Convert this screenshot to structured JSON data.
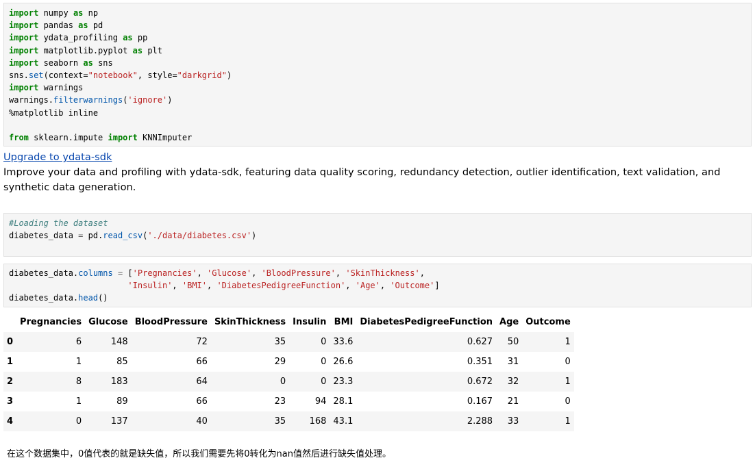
{
  "cell1": {
    "lines": [
      [
        {
          "t": "import",
          "c": "kw"
        },
        {
          "t": " numpy "
        },
        {
          "t": "as",
          "c": "kw"
        },
        {
          "t": " np"
        }
      ],
      [
        {
          "t": "import",
          "c": "kw"
        },
        {
          "t": " pandas "
        },
        {
          "t": "as",
          "c": "kw"
        },
        {
          "t": " pd"
        }
      ],
      [
        {
          "t": "import",
          "c": "kw"
        },
        {
          "t": " ydata_profiling "
        },
        {
          "t": "as",
          "c": "kw"
        },
        {
          "t": " pp"
        }
      ],
      [
        {
          "t": "import",
          "c": "kw"
        },
        {
          "t": " matplotlib.pyplot "
        },
        {
          "t": "as",
          "c": "kw"
        },
        {
          "t": " plt"
        }
      ],
      [
        {
          "t": "import",
          "c": "kw"
        },
        {
          "t": " seaborn "
        },
        {
          "t": "as",
          "c": "kw"
        },
        {
          "t": " sns"
        }
      ],
      [
        {
          "t": "sns."
        },
        {
          "t": "set",
          "c": "fn"
        },
        {
          "t": "(context="
        },
        {
          "t": "\"notebook\"",
          "c": "str"
        },
        {
          "t": ", style="
        },
        {
          "t": "\"darkgrid\"",
          "c": "str"
        },
        {
          "t": ")"
        }
      ],
      [
        {
          "t": "import",
          "c": "kw"
        },
        {
          "t": " warnings"
        }
      ],
      [
        {
          "t": "warnings."
        },
        {
          "t": "filterwarnings",
          "c": "fn"
        },
        {
          "t": "("
        },
        {
          "t": "'ignore'",
          "c": "str"
        },
        {
          "t": ")"
        }
      ],
      [
        {
          "t": "%matplotlib inline"
        }
      ],
      [
        {
          "t": ""
        }
      ],
      [
        {
          "t": "from",
          "c": "kw"
        },
        {
          "t": " sklearn.impute "
        },
        {
          "t": "import",
          "c": "kw"
        },
        {
          "t": " KNNImputer"
        }
      ]
    ]
  },
  "markdown1": {
    "link_text": "Upgrade to ydata-sdk",
    "body": "Improve your data and profiling with ydata-sdk, featuring data quality scoring, redundancy detection, outlier identification, text validation, and synthetic data generation."
  },
  "cell2": {
    "lines": [
      [
        {
          "t": "#Loading the dataset",
          "c": "cmt"
        }
      ],
      [
        {
          "t": "diabetes_data "
        },
        {
          "t": "=",
          "c": "op"
        },
        {
          "t": " pd."
        },
        {
          "t": "read_csv",
          "c": "fn"
        },
        {
          "t": "("
        },
        {
          "t": "'./data/diabetes.csv'",
          "c": "str"
        },
        {
          "t": ")"
        }
      ]
    ]
  },
  "cell3": {
    "lines": [
      [
        {
          "t": "diabetes_data."
        },
        {
          "t": "columns",
          "c": "fn"
        },
        {
          "t": " "
        },
        {
          "t": "=",
          "c": "op"
        },
        {
          "t": " ["
        },
        {
          "t": "'Pregnancies'",
          "c": "str"
        },
        {
          "t": ", "
        },
        {
          "t": "'Glucose'",
          "c": "str"
        },
        {
          "t": ", "
        },
        {
          "t": "'BloodPressure'",
          "c": "str"
        },
        {
          "t": ", "
        },
        {
          "t": "'SkinThickness'",
          "c": "str"
        },
        {
          "t": ","
        }
      ],
      [
        {
          "t": "                        "
        },
        {
          "t": "'Insulin'",
          "c": "str"
        },
        {
          "t": ", "
        },
        {
          "t": "'BMI'",
          "c": "str"
        },
        {
          "t": ", "
        },
        {
          "t": "'DiabetesPedigreeFunction'",
          "c": "str"
        },
        {
          "t": ", "
        },
        {
          "t": "'Age'",
          "c": "str"
        },
        {
          "t": ", "
        },
        {
          "t": "'Outcome'",
          "c": "str"
        },
        {
          "t": "]"
        }
      ],
      [
        {
          "t": "diabetes_data."
        },
        {
          "t": "head",
          "c": "fn"
        },
        {
          "t": "()"
        }
      ]
    ]
  },
  "table": {
    "columns": [
      "",
      "Pregnancies",
      "Glucose",
      "BloodPressure",
      "SkinThickness",
      "Insulin",
      "BMI",
      "DiabetesPedigreeFunction",
      "Age",
      "Outcome"
    ],
    "rows": [
      [
        "0",
        "6",
        "148",
        "72",
        "35",
        "0",
        "33.6",
        "0.627",
        "50",
        "1"
      ],
      [
        "1",
        "1",
        "85",
        "66",
        "29",
        "0",
        "26.6",
        "0.351",
        "31",
        "0"
      ],
      [
        "2",
        "8",
        "183",
        "64",
        "0",
        "0",
        "23.3",
        "0.672",
        "32",
        "1"
      ],
      [
        "3",
        "1",
        "89",
        "66",
        "23",
        "94",
        "28.1",
        "0.167",
        "21",
        "0"
      ],
      [
        "4",
        "0",
        "137",
        "40",
        "35",
        "168",
        "43.1",
        "2.288",
        "33",
        "1"
      ]
    ]
  },
  "note": "在这个数据集中，0值代表的就是缺失值，所以我们需要先将0转化为nan值然后进行缺失值处理。"
}
